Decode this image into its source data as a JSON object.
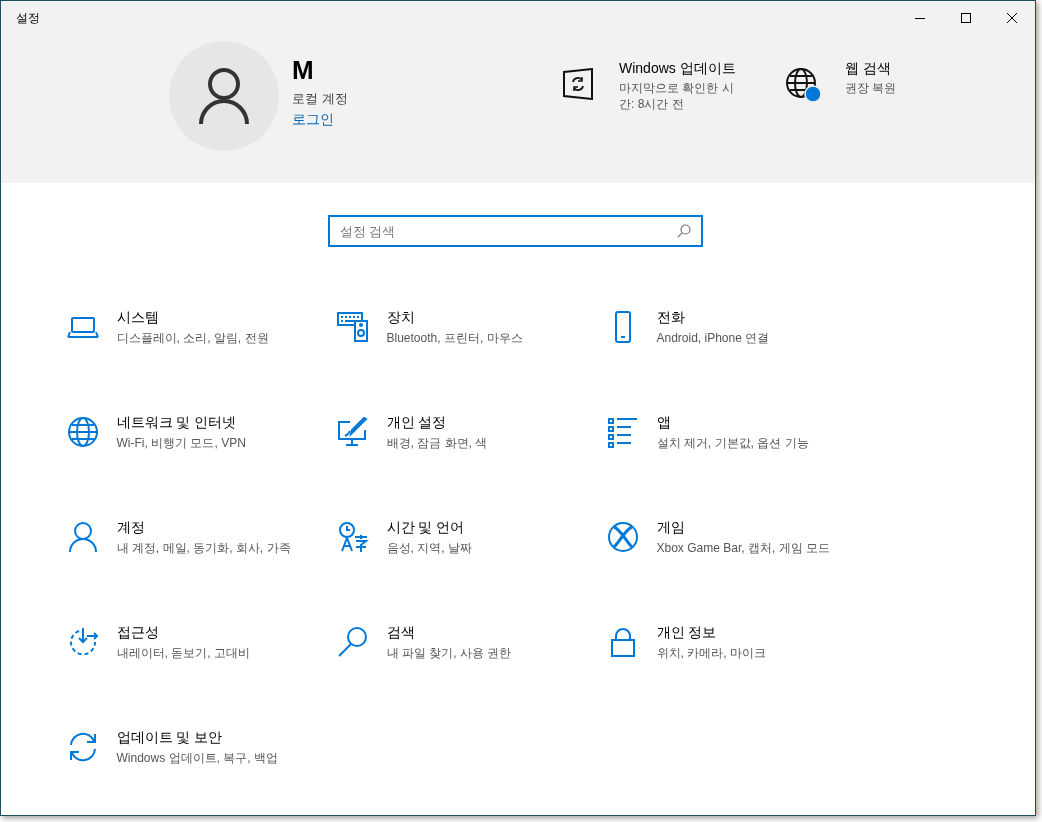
{
  "window": {
    "title": "설정"
  },
  "account": {
    "name": "M",
    "type": "로컬 계정",
    "link": "로그인"
  },
  "status_tiles": [
    {
      "title": "Windows 업데이트",
      "subtitle": "마지막으로 확인한 시간: 8시간 전"
    },
    {
      "title": "웹 검색",
      "subtitle": "권장 복원"
    }
  ],
  "search": {
    "placeholder": "설정 검색"
  },
  "categories": [
    {
      "title": "시스템",
      "description": "디스플레이, 소리, 알림, 전원"
    },
    {
      "title": "장치",
      "description": "Bluetooth, 프린터, 마우스"
    },
    {
      "title": "전화",
      "description": "Android, iPhone 연결"
    },
    {
      "title": "네트워크 및 인터넷",
      "description": "Wi-Fi, 비행기 모드, VPN"
    },
    {
      "title": "개인 설정",
      "description": "배경, 잠금 화면, 색"
    },
    {
      "title": "앱",
      "description": "설치 제거, 기본값, 옵션 기능"
    },
    {
      "title": "계정",
      "description": "내 계정, 메일, 동기화, 회사, 가족"
    },
    {
      "title": "시간 및 언어",
      "description": "음성, 지역, 날짜"
    },
    {
      "title": "게임",
      "description": "Xbox Game Bar, 캡처, 게임 모드"
    },
    {
      "title": "접근성",
      "description": "내레이터, 돋보기, 고대비"
    },
    {
      "title": "검색",
      "description": "내 파일 찾기, 사용 권한"
    },
    {
      "title": "개인 정보",
      "description": "위치, 카메라, 마이크"
    },
    {
      "title": "업데이트 및 보안",
      "description": "Windows 업데이트, 복구, 백업"
    }
  ]
}
